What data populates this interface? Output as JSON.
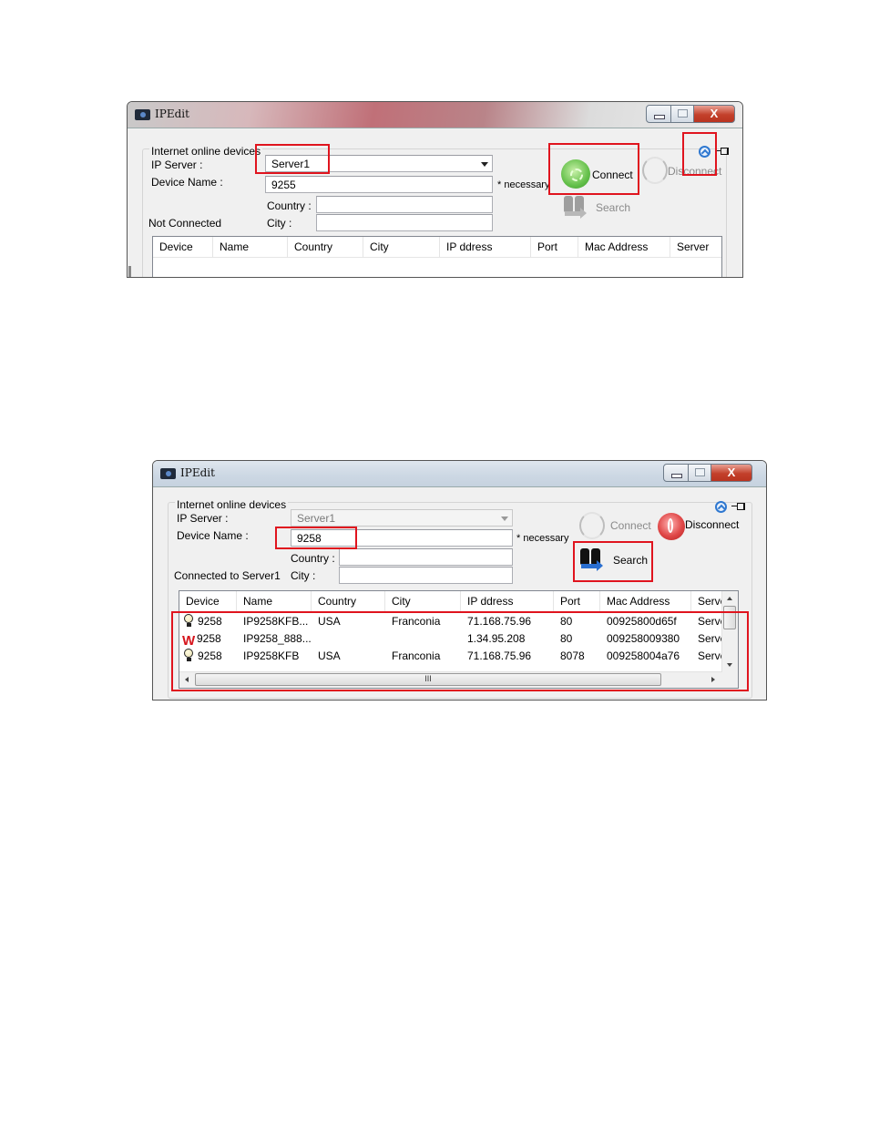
{
  "window1": {
    "title": "IPEdit",
    "close_glyph": "X",
    "group_label": "Internet online devices",
    "ip_server_label": "IP Server :",
    "ip_server_value": "Server1",
    "device_name_label": "Device Name :",
    "device_name_value": "9255",
    "necessary_note": "* necessary",
    "country_label": "Country :",
    "country_value": "",
    "city_label": "City :",
    "city_value": "",
    "status": "Not Connected",
    "connect_label": "Connect",
    "disconnect_label": "Disconnect",
    "search_label": "Search",
    "icons": {
      "collapse": "collapse-up-icon",
      "pin": "pin-icon"
    },
    "columns": [
      "Device",
      "Name",
      "Country",
      "City",
      "IP ddress",
      "Port",
      "Mac Address",
      "Server"
    ],
    "rows": []
  },
  "window2": {
    "title": "IPEdit",
    "close_glyph": "X",
    "group_label": "Internet online devices",
    "ip_server_label": "IP Server :",
    "ip_server_value": "Server1",
    "device_name_label": "Device Name :",
    "device_name_value": "9258",
    "necessary_note": "* necessary",
    "country_label": "Country :",
    "country_value": "",
    "city_label": "City :",
    "city_value": "",
    "status": "Connected to Server1",
    "connect_label": "Connect",
    "disconnect_label": "Disconnect",
    "search_label": "Search",
    "columns": [
      "Device",
      "Name",
      "Country",
      "City",
      "IP ddress",
      "Port",
      "Mac Address",
      "Serve"
    ],
    "rows": [
      {
        "icon": "bulb-icon",
        "device": "9258",
        "name": "IP9258KFB...",
        "country": "USA",
        "city": "Franconia",
        "ip": "71.168.75.96",
        "port": "80",
        "mac": "00925800d65f",
        "server": "Serve"
      },
      {
        "icon": "w-logo-icon",
        "device": "9258",
        "name": "IP9258_888...",
        "country": "",
        "city": "",
        "ip": "1.34.95.208",
        "port": "80",
        "mac": "009258009380",
        "server": "Serve"
      },
      {
        "icon": "bulb-icon",
        "device": "9258",
        "name": "IP9258KFB",
        "country": "USA",
        "city": "Franconia",
        "ip": "71.168.75.96",
        "port": "8078",
        "mac": "009258004a76",
        "server": "Serve"
      }
    ],
    "scroll_grip": "III",
    "w_glyph": "W"
  }
}
